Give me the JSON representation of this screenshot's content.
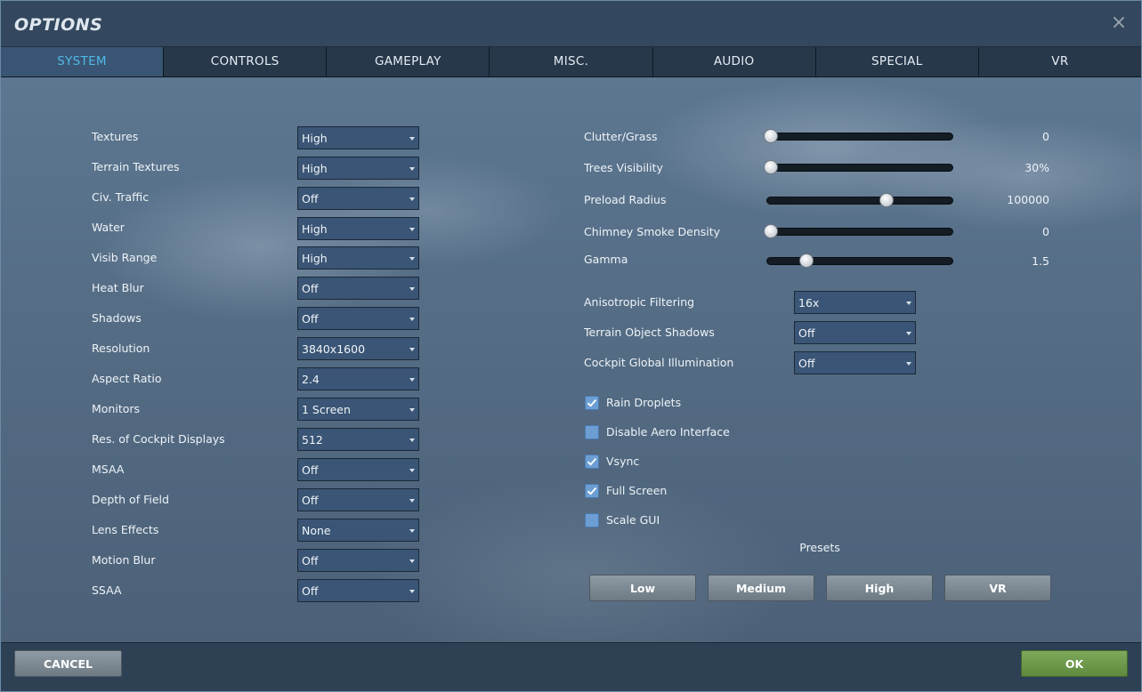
{
  "window": {
    "title": "OPTIONS"
  },
  "tabs": [
    "SYSTEM",
    "CONTROLS",
    "GAMEPLAY",
    "MISC.",
    "AUDIO",
    "SPECIAL",
    "VR"
  ],
  "active_tab": "SYSTEM",
  "settings_left": [
    {
      "label": "Textures",
      "value": "High"
    },
    {
      "label": "Terrain Textures",
      "value": "High"
    },
    {
      "label": "Civ. Traffic",
      "value": "Off"
    },
    {
      "label": "Water",
      "value": "High"
    },
    {
      "label": "Visib Range",
      "value": "High"
    },
    {
      "label": "Heat Blur",
      "value": "Off"
    },
    {
      "label": "Shadows",
      "value": "Off"
    },
    {
      "label": "Resolution",
      "value": "3840x1600"
    },
    {
      "label": "Aspect Ratio",
      "value": "2.4"
    },
    {
      "label": "Monitors",
      "value": "1 Screen"
    },
    {
      "label": "Res. of Cockpit Displays",
      "value": "512"
    },
    {
      "label": "MSAA",
      "value": "Off"
    },
    {
      "label": "Depth of Field",
      "value": "Off"
    },
    {
      "label": "Lens Effects",
      "value": "None"
    },
    {
      "label": "Motion Blur",
      "value": "Off"
    },
    {
      "label": "SSAA",
      "value": "Off"
    }
  ],
  "sliders": [
    {
      "label": "Clutter/Grass",
      "value": "0",
      "fraction": 0.0
    },
    {
      "label": "Trees Visibility",
      "value": "30%",
      "fraction": 0.0
    },
    {
      "label": "Preload Radius",
      "value": "100000",
      "fraction": 0.65
    },
    {
      "label": "Chimney Smoke Density",
      "value": "0",
      "fraction": 0.0
    },
    {
      "label": "Gamma",
      "value": "1.5",
      "fraction": 0.2
    }
  ],
  "settings_right": [
    {
      "label": "Anisotropic Filtering",
      "value": "16x"
    },
    {
      "label": "Terrain Object Shadows",
      "value": "Off"
    },
    {
      "label": "Cockpit Global Illumination",
      "value": "Off"
    }
  ],
  "checkboxes": [
    {
      "label": "Rain Droplets",
      "checked": true
    },
    {
      "label": "Disable Aero Interface",
      "checked": false
    },
    {
      "label": "Vsync",
      "checked": true
    },
    {
      "label": "Full Screen",
      "checked": true
    },
    {
      "label": "Scale GUI",
      "checked": false
    }
  ],
  "presets": {
    "label": "Presets",
    "buttons": [
      "Low",
      "Medium",
      "High",
      "VR"
    ]
  },
  "footer": {
    "cancel_label": "CANCEL",
    "ok_label": "OK"
  },
  "colors": {
    "active_tab": "#4fb9e6",
    "ok_button": "#6f9a4c",
    "checkbox": "#6c9ed4"
  }
}
